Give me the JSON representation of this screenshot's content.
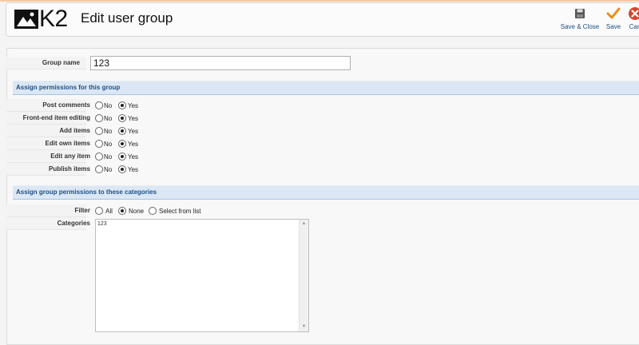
{
  "header": {
    "logo_text": "K2",
    "title": "Edit user group",
    "toolbar": [
      {
        "label": "Save & Close",
        "icon": "save-close-icon"
      },
      {
        "label": "Save",
        "icon": "checkmark-icon"
      },
      {
        "label": "Can",
        "icon": "cancel-icon"
      }
    ]
  },
  "form": {
    "group_name_label": "Group name",
    "group_name_value": "123",
    "permissions_section": "Assign permissions for this group",
    "permissions": [
      {
        "label": "Post comments",
        "no": "No",
        "yes": "Yes",
        "selected": "Yes"
      },
      {
        "label": "Front-end item editing",
        "no": "No",
        "yes": "Yes",
        "selected": "Yes"
      },
      {
        "label": "Add items",
        "no": "No",
        "yes": "Yes",
        "selected": "Yes"
      },
      {
        "label": "Edit own items",
        "no": "No",
        "yes": "Yes",
        "selected": "Yes"
      },
      {
        "label": "Edit any item",
        "no": "No",
        "yes": "Yes",
        "selected": "Yes"
      },
      {
        "label": "Publish items",
        "no": "No",
        "yes": "Yes",
        "selected": "Yes"
      }
    ],
    "categories_section": "Assign group permissions to these categories",
    "filter_label": "Filter",
    "filter_options": [
      "All",
      "None",
      "Select from list"
    ],
    "filter_selected": "None",
    "categories_label": "Categories",
    "categories_items": [
      "123"
    ]
  },
  "colors": {
    "section_bg": "#dbe7f4",
    "section_text": "#1f4f86",
    "save_check": "#e8901a",
    "cancel_red": "#d9452b"
  }
}
